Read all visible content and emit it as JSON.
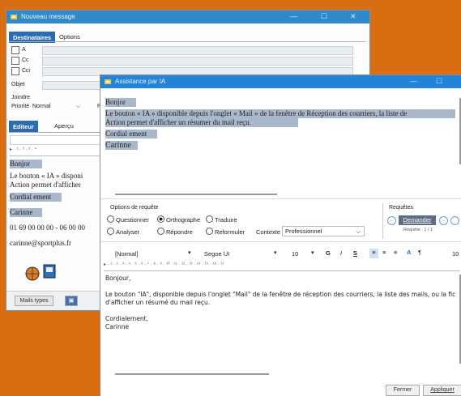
{
  "nouveau": {
    "title": "Nouveau message",
    "tabs": [
      "Destinataires",
      "Options"
    ],
    "recips": [
      "A",
      "Cc",
      "Cci"
    ],
    "objet_label": "Objet",
    "joindre_label": "Joindre",
    "priorite_label": "Priorité",
    "priorite_value": "Normal",
    "partial_p": "P",
    "editor_tabs": [
      "Editeur RTF",
      "Aperçu"
    ],
    "body": {
      "greeting": "Bonjor",
      "p1a": "Le bouton « IA » disponi",
      "p1b": "Action permet d'afficher",
      "closing": "Cordial ement",
      "name": "Carinne",
      "phone": "01 69 00 00 00 - 06 00 00",
      "email": "carinne@sportplus.fr"
    },
    "mails_types": "Mails types"
  },
  "ia": {
    "title": "Assistance par IA",
    "source": {
      "greeting": "Bonjor",
      "p1": "Le bouton « IA » disponible depuis l'onglet « Mail » de la fenêtre de Réception des courriers, la liste de",
      "p2": "Action permet d'afficher un résumer du mail reçu.",
      "closing": "Cordial ement",
      "name": "Carinne"
    },
    "options_label": "Options de requête",
    "options": [
      "Questionner",
      "Orthographe",
      "Traduire",
      "Analyser",
      "Répondre",
      "Reformuler"
    ],
    "selected_option": "Orthographe",
    "contexte_label": "Contexte",
    "contexte_value": "Professionnel",
    "requetes_label": "Requêtes",
    "demander": "Demander",
    "requete_count": "Requête : 1 / 1",
    "toolbar": {
      "style": "[Normal]",
      "font": "Segoe UI",
      "size": "10",
      "bold": "G",
      "italic": "I",
      "underline": "S",
      "zoom_partial": "10"
    },
    "result": {
      "greeting": "Bonjour,",
      "p1": "Le bouton \"IA\", disponible depuis l'onglet \"Mail\" de la fenêtre de réception des courriers, la liste des mails, ou la fic",
      "p2": "d'afficher un résumé du mail reçu.",
      "closing": "Cordialement,",
      "name": "Carinne"
    },
    "fermer": "Fermer",
    "appliquer": "Appliquer"
  }
}
